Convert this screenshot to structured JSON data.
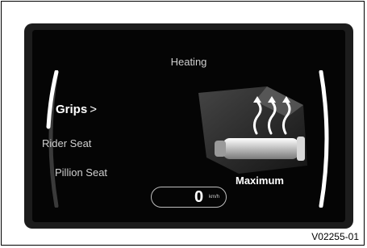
{
  "screen": {
    "title": "Heating",
    "menu": [
      {
        "label": "Grips",
        "chevron": ">",
        "selected": true
      },
      {
        "label": "Rider Seat",
        "selected": false
      },
      {
        "label": "Pillion Seat",
        "selected": false
      }
    ],
    "heat_level": "Maximum",
    "speed": {
      "value": "0",
      "unit": "km/h"
    },
    "illustration": "heated-grip-icon"
  },
  "caption": "V02255-01"
}
